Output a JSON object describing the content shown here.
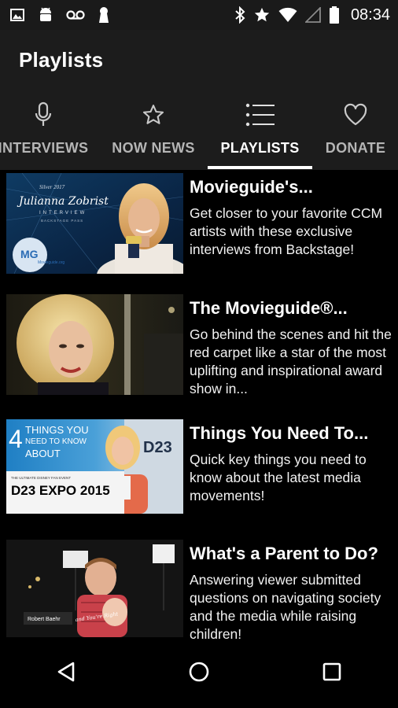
{
  "status_bar": {
    "time": "08:34",
    "left_icons": [
      "image-icon",
      "android-icon",
      "voicemail-icon",
      "keyhole-icon"
    ],
    "right_icons": [
      "bluetooth-icon",
      "star-icon",
      "wifi-icon",
      "signal-icon",
      "battery-icon"
    ]
  },
  "app_bar": {
    "title": "Playlists"
  },
  "tabs": [
    {
      "label": "INTERVIEWS",
      "icon": "microphone-icon",
      "active": false
    },
    {
      "label": "NOW NEWS",
      "icon": "star-outline-icon",
      "active": false
    },
    {
      "label": "PLAYLISTS",
      "icon": "list-icon",
      "active": true
    },
    {
      "label": "DONATE",
      "icon": "heart-outline-icon",
      "active": false
    }
  ],
  "playlists": [
    {
      "title": "Movieguide's...",
      "description": "Get closer to your favorite CCM artists with these exclusive interviews from Backstage!",
      "thumb": {
        "kicker": "Silver 2017",
        "name": "Julianna Zobrist",
        "sub": "INTERVIEW",
        "sub2": "BACKSTAGE PASS",
        "logo": "MG",
        "logo_text": "Movieguide.org"
      }
    },
    {
      "title": "The Movieguide®...",
      "description": "Go behind the scenes and hit the red carpet like a star of the most uplifting and inspirational award show in..."
    },
    {
      "title": "Things You Need To...",
      "description": "Quick key things you need to know about the latest media movements!",
      "thumb": {
        "line1": "THINGS YOU",
        "line2": "NEED TO KNOW",
        "line3": "ABOUT",
        "number": "4",
        "small": "THE ULTIMATE DISNEY FAN EVENT",
        "expo": "D23 EXPO 2015",
        "wall": "D23"
      }
    },
    {
      "title": "What's a Parent to Do?",
      "description": "Answering viewer submitted questions on navigating society and the media while raising children!",
      "thumb": {
        "name": "Robert Baehr",
        "caption": "and You're Right"
      }
    }
  ],
  "nav_bar": {
    "icons": [
      "back-icon",
      "home-icon",
      "recents-icon"
    ]
  },
  "colors": {
    "background": "#000000",
    "app_bar": "#1c1c1c",
    "tab_inactive": "#b5b5b5",
    "text": "#ffffff"
  }
}
